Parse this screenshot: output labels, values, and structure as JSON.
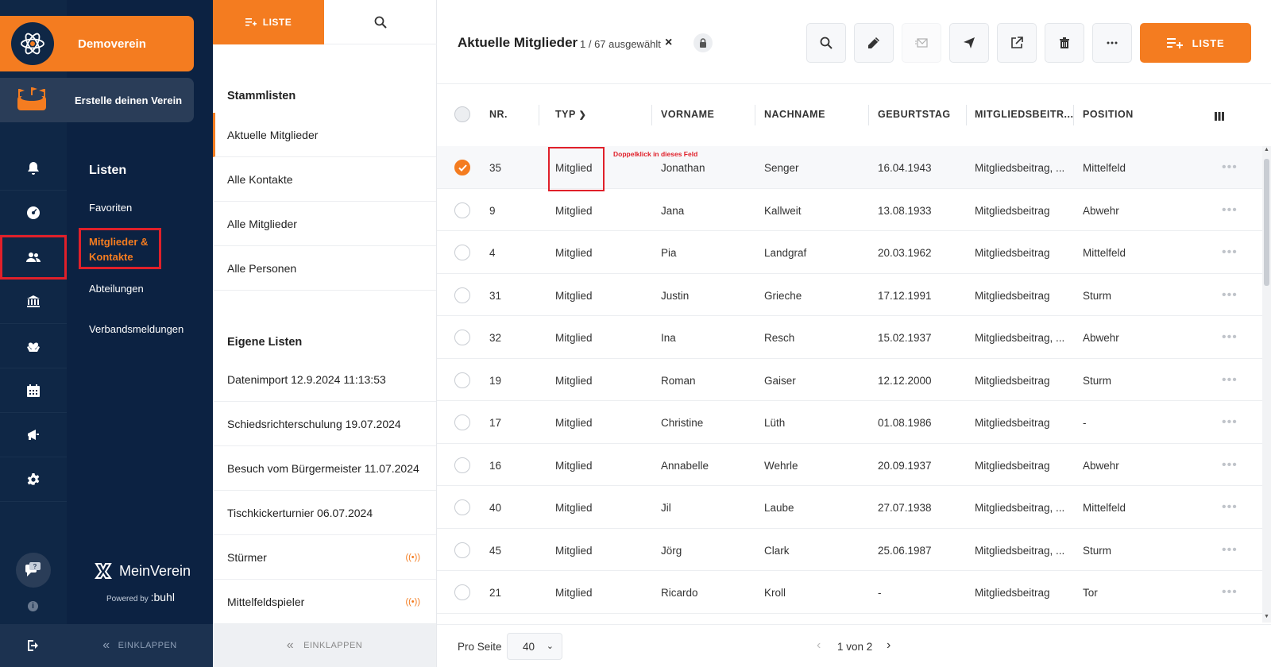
{
  "brand": {
    "name": "Demoverein",
    "create_label": "Erstelle deinen Verein"
  },
  "nav": {
    "heading": "Listen",
    "links": [
      "Favoriten",
      "Mitglieder & Kontakte",
      "Abteilungen",
      "Verbandsmeldungen"
    ],
    "active_label": "Mitglieder & Kontakte",
    "product_name": "MeinVerein",
    "powered_by": "Powered by",
    "powered_brand": ":buhl",
    "collapse_label": "EINKLAPPEN"
  },
  "lists": {
    "tab_label": "LISTE",
    "section_master": "Stammlisten",
    "master_items": [
      "Aktuelle Mitglieder",
      "Alle Kontakte",
      "Alle Mitglieder",
      "Alle Personen"
    ],
    "section_own": "Eigene Listen",
    "own_items": [
      "Datenimport 12.9.2024 11:13:53",
      "Schiedsrichterschulung 19.07.2024",
      "Besuch vom Bürgermeister 11.07.2024",
      "Tischkickerturnier 06.07.2024",
      "Stürmer",
      "Mittelfeldspieler"
    ],
    "live_icon": "((•))",
    "collapse_label": "EINKLAPPEN"
  },
  "main": {
    "title": "Aktuelle Mitglieder",
    "selection": "1 / 67 ausgewählt",
    "close_glyph": "×",
    "add_button": "LISTE",
    "hint": "Doppelklick in dieses Feld",
    "more_glyph": "•••",
    "columns": [
      "NR.",
      "TYP",
      "VORNAME",
      "NACHNAME",
      "GEBURTSTAG",
      "MITGLIEDSBEITR...",
      "POSITION"
    ],
    "rows": [
      {
        "nr": "35",
        "typ": "Mitglied",
        "vorname": "Jonathan",
        "nachname": "Senger",
        "geburtstag": "16.04.1943",
        "beitrag": "Mitgliedsbeitrag, ...",
        "position": "Mittelfeld"
      },
      {
        "nr": "9",
        "typ": "Mitglied",
        "vorname": "Jana",
        "nachname": "Kallweit",
        "geburtstag": "13.08.1933",
        "beitrag": "Mitgliedsbeitrag",
        "position": "Abwehr"
      },
      {
        "nr": "4",
        "typ": "Mitglied",
        "vorname": "Pia",
        "nachname": "Landgraf",
        "geburtstag": "20.03.1962",
        "beitrag": "Mitgliedsbeitrag",
        "position": "Mittelfeld"
      },
      {
        "nr": "31",
        "typ": "Mitglied",
        "vorname": "Justin",
        "nachname": "Grieche",
        "geburtstag": "17.12.1991",
        "beitrag": "Mitgliedsbeitrag",
        "position": "Sturm"
      },
      {
        "nr": "32",
        "typ": "Mitglied",
        "vorname": "Ina",
        "nachname": "Resch",
        "geburtstag": "15.02.1937",
        "beitrag": "Mitgliedsbeitrag, ...",
        "position": "Abwehr"
      },
      {
        "nr": "19",
        "typ": "Mitglied",
        "vorname": "Roman",
        "nachname": "Gaiser",
        "geburtstag": "12.12.2000",
        "beitrag": "Mitgliedsbeitrag",
        "position": "Sturm"
      },
      {
        "nr": "17",
        "typ": "Mitglied",
        "vorname": "Christine",
        "nachname": "Lüth",
        "geburtstag": "01.08.1986",
        "beitrag": "Mitgliedsbeitrag",
        "position": "-"
      },
      {
        "nr": "16",
        "typ": "Mitglied",
        "vorname": "Annabelle",
        "nachname": "Wehrle",
        "geburtstag": "20.09.1937",
        "beitrag": "Mitgliedsbeitrag",
        "position": "Abwehr"
      },
      {
        "nr": "40",
        "typ": "Mitglied",
        "vorname": "Jil",
        "nachname": "Laube",
        "geburtstag": "27.07.1938",
        "beitrag": "Mitgliedsbeitrag, ...",
        "position": "Mittelfeld"
      },
      {
        "nr": "45",
        "typ": "Mitglied",
        "vorname": "Jörg",
        "nachname": "Clark",
        "geburtstag": "25.06.1987",
        "beitrag": "Mitgliedsbeitrag, ...",
        "position": "Sturm"
      },
      {
        "nr": "21",
        "typ": "Mitglied",
        "vorname": "Ricardo",
        "nachname": "Kroll",
        "geburtstag": "-",
        "beitrag": "Mitgliedsbeitrag",
        "position": "Tor"
      }
    ],
    "selected_row_index": 0
  },
  "footer": {
    "per_page_label": "Pro Seite",
    "per_page_value": "40",
    "pager": "1 von 2"
  },
  "colors": {
    "accent": "#f47c20",
    "navy": "#0f2746",
    "highlight": "#e0202a"
  },
  "icons": [
    "atom-logo-icon",
    "stadium-icon",
    "bell-icon",
    "dashboard-icon",
    "members-icon",
    "bank-icon",
    "donation-icon",
    "calendar-icon",
    "megaphone-icon",
    "gear-icon",
    "help-chat-icon",
    "info-icon",
    "logout-icon",
    "search-icon",
    "pencil-icon",
    "mail-icon",
    "send-icon",
    "export-icon",
    "trash-icon",
    "more-icon",
    "lock-icon",
    "columns-icon"
  ]
}
